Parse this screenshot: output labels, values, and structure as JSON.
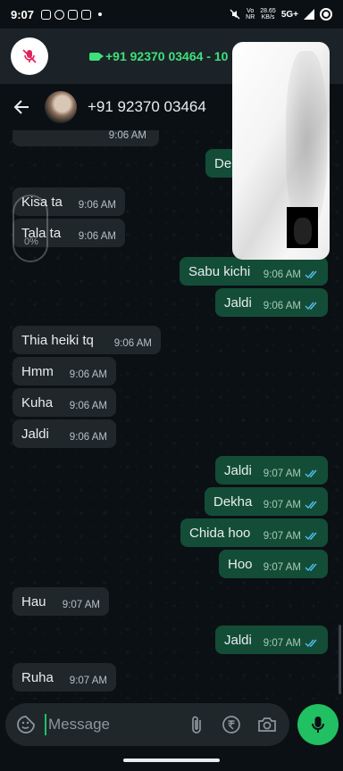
{
  "status_bar": {
    "time": "9:07",
    "speed_value": "28.65",
    "speed_unit": "KB/s",
    "network": "5G+",
    "volte": "Vo",
    "volte_sub": "NR"
  },
  "call_bar": {
    "text": "+91 92370 03464 - 10"
  },
  "header": {
    "contact": "+91 92370 03464"
  },
  "progress": {
    "label": "0%",
    "value": 0
  },
  "messages": [
    {
      "dir": "in",
      "text": "",
      "time": "9:06 AM"
    },
    {
      "dir": "out",
      "text": "De",
      "time": ""
    },
    {
      "dir": "in",
      "text": "Kisa ta",
      "time": "9:06 AM"
    },
    {
      "dir": "in",
      "text": "Tala ta",
      "time": "9:06 AM"
    },
    {
      "dir": "out",
      "text": "Sabu kichi",
      "time": "9:06 AM"
    },
    {
      "dir": "out",
      "text": "Jaldi",
      "time": "9:06 AM"
    },
    {
      "dir": "in",
      "text": "Thia heiki tq",
      "time": "9:06 AM"
    },
    {
      "dir": "in",
      "text": "Hmm",
      "time": "9:06 AM"
    },
    {
      "dir": "in",
      "text": "Kuha",
      "time": "9:06 AM"
    },
    {
      "dir": "in",
      "text": "Jaldi",
      "time": "9:06 AM"
    },
    {
      "dir": "out",
      "text": "Jaldi",
      "time": "9:07 AM"
    },
    {
      "dir": "out",
      "text": "Dekha",
      "time": "9:07 AM"
    },
    {
      "dir": "out",
      "text": "Chida hoo",
      "time": "9:07 AM"
    },
    {
      "dir": "out",
      "text": "Hoo",
      "time": "9:07 AM"
    },
    {
      "dir": "in",
      "text": "Hau",
      "time": "9:07 AM"
    },
    {
      "dir": "out",
      "text": "Jaldi",
      "time": "9:07 AM"
    },
    {
      "dir": "in",
      "text": "Ruha",
      "time": "9:07 AM"
    }
  ],
  "input": {
    "placeholder": "Message"
  },
  "colors": {
    "accent": "#21c063",
    "incoming_bubble": "#1f272b",
    "outgoing_bubble": "#134d37",
    "read_ticks": "#53bdeb"
  }
}
